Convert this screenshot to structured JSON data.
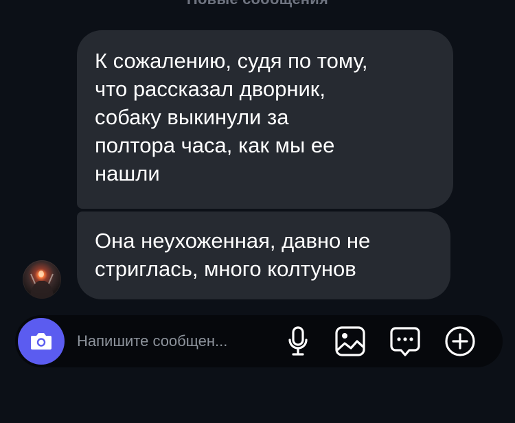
{
  "chat": {
    "new_messages_label": "Новые сообщения",
    "messages": [
      {
        "text": "К сожалению, судя по тому,\nчто рассказал дворник,\nсобаку выкинули за\nполтора часа, как мы ее\nнашли"
      },
      {
        "text": "Она неухоженная, давно не\nстриглась, много колтунов"
      }
    ]
  },
  "composer": {
    "placeholder": "Напишите сообщен...",
    "camera_color": "#5b5cf0",
    "icons": [
      "camera-icon",
      "microphone-icon",
      "gallery-icon",
      "sticker-icon",
      "plus-icon"
    ]
  },
  "theme": {
    "background": "#0c1017",
    "bubble": "#262a31",
    "text": "#ffffff"
  }
}
